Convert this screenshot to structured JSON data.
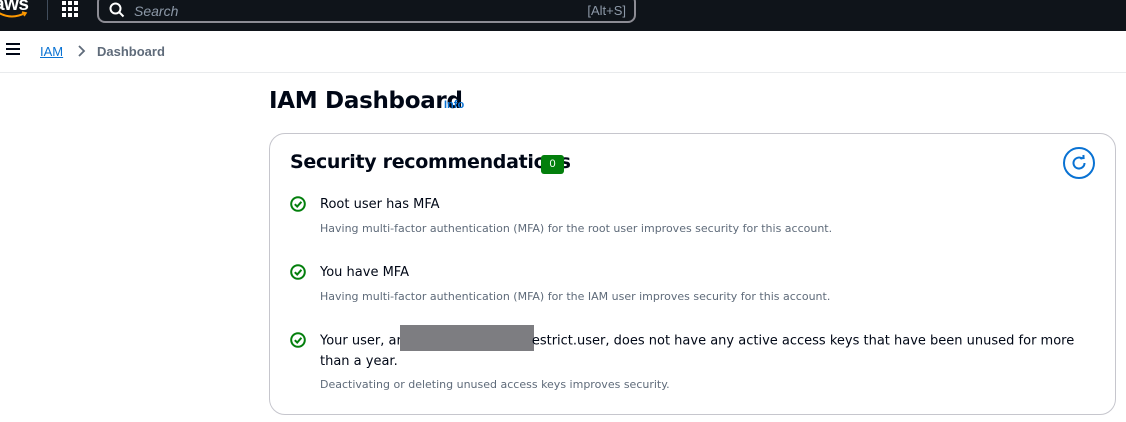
{
  "topnav": {
    "logo_text": "aws",
    "search_placeholder": "Search",
    "search_shortcut": "[Alt+S]"
  },
  "breadcrumb": {
    "items": [
      "IAM",
      "Dashboard"
    ]
  },
  "page": {
    "title": "IAM Dashboard",
    "info_label": "Info"
  },
  "security": {
    "title": "Security recommendations",
    "count": "0",
    "items": [
      {
        "title": "Root user has MFA",
        "description": "Having multi-factor authentication (MFA) for the root user improves security for this account."
      },
      {
        "title": "You have MFA",
        "description": "Having multi-factor authentication (MFA) for the IAM user improves security for this account."
      },
      {
        "title_prefix": "Your user, ar",
        "title_suffix": "estrict.user, does not have any active access keys that have been unused for more than a year.",
        "description": "Deactivating or deleting unused access keys improves security."
      }
    ]
  },
  "colors": {
    "nav_bg": "#0f141a",
    "link": "#0972d3",
    "success": "#037f0c"
  }
}
